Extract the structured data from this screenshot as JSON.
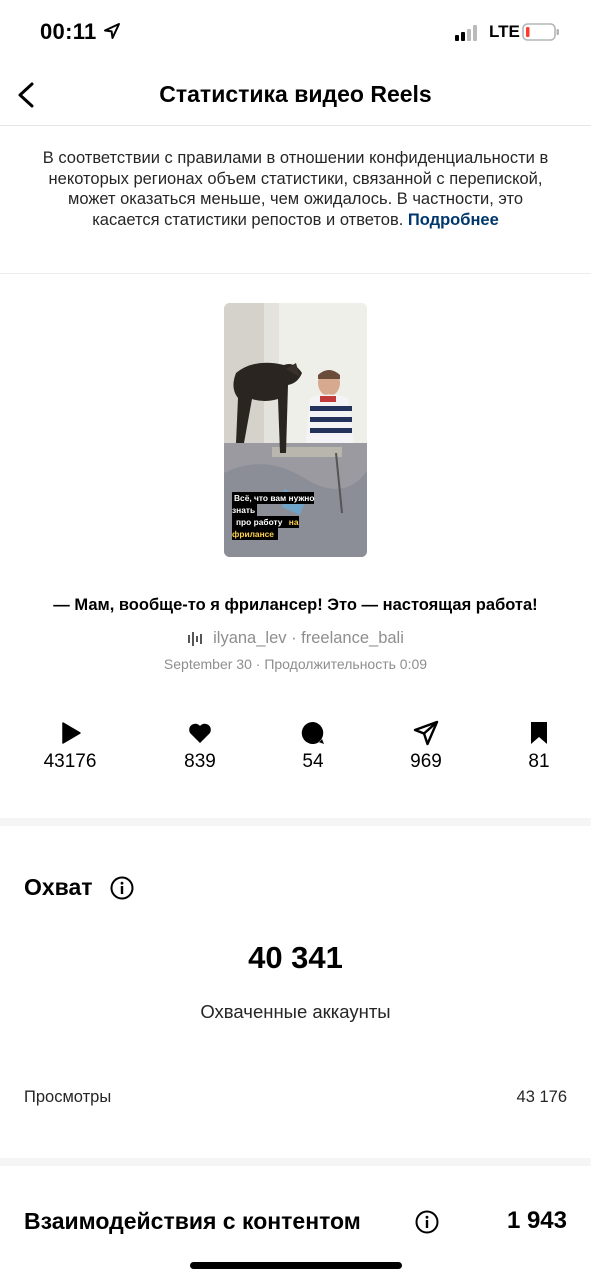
{
  "status_bar": {
    "time": "00:11",
    "network": "LTE"
  },
  "header": {
    "title": "Статистика видео Reels"
  },
  "notice": {
    "text": "В соответствии с правилами в отношении конфиденциальности в некоторых регионах объем статистики, связанной с перепиской, может оказаться меньше, чем ожидалось. В частности, это касается статистики репостов и ответов.",
    "link": "Подробнее"
  },
  "reel": {
    "overlay_text": "Всё, что вам нужно знать",
    "overlay_text_2": "про работу",
    "overlay_highlight": "на фрилансе",
    "caption": "— Мам, вообще-то я фрилансер! Это — настоящая работа!",
    "audio": "ilyana_lev · freelance_bali",
    "date": "September 30",
    "duration_label": "Продолжительность 0:09"
  },
  "metrics": [
    {
      "icon": "play-icon",
      "value": "43176"
    },
    {
      "icon": "heart-icon",
      "value": "839"
    },
    {
      "icon": "comment-icon",
      "value": "54"
    },
    {
      "icon": "share-icon",
      "value": "969"
    },
    {
      "icon": "bookmark-icon",
      "value": "81"
    }
  ],
  "reach": {
    "title": "Охват",
    "value": "40 341",
    "label": "Охваченные аккаунты",
    "views_label": "Просмотры",
    "views_value": "43 176"
  },
  "engagement": {
    "title": "Взаимодействия с контентом",
    "value": "1 943"
  },
  "colors": {
    "link": "#00376b",
    "secondary_text": "#8e8e8e",
    "battery_low": "#ff3b30"
  }
}
